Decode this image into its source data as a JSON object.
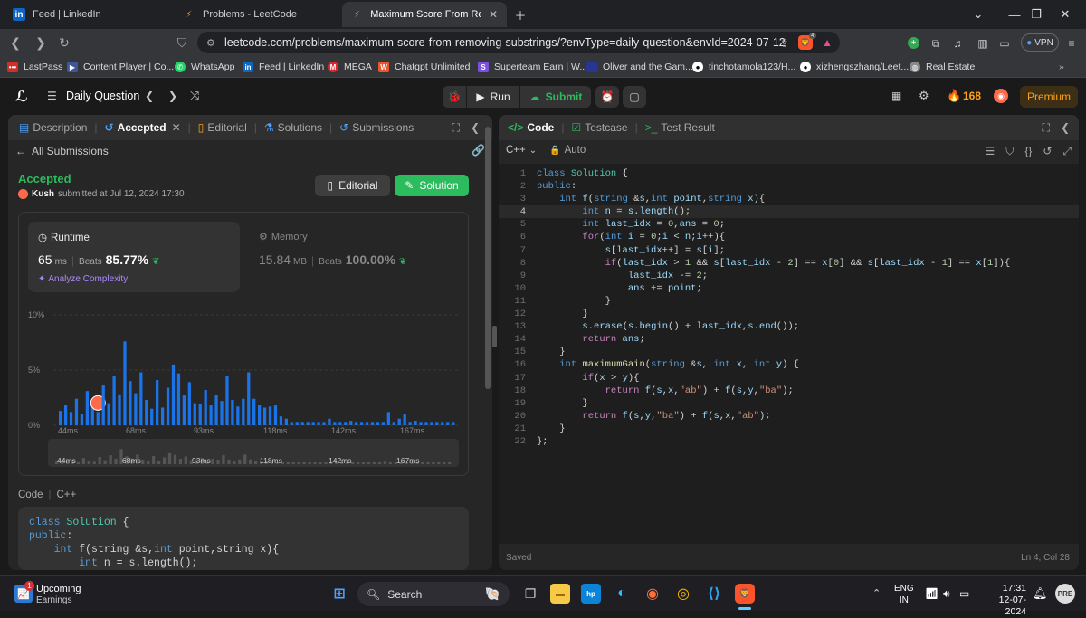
{
  "browser": {
    "tabs": [
      {
        "title": "Feed | LinkedIn",
        "favicon": "in"
      },
      {
        "title": "Problems - LeetCode",
        "favicon": "lc"
      },
      {
        "title": "Maximum Score From Removing",
        "favicon": "lc",
        "active": true
      }
    ],
    "url": "leetcode.com/problems/maximum-score-from-removing-substrings/?envType=daily-question&envId=2024-07-12",
    "vpn_label": "VPN",
    "brave_badge": "4",
    "bookmarks": [
      "LastPass",
      "Content Player | Co...",
      "WhatsApp",
      "Feed | LinkedIn",
      "MEGA",
      "Chatgpt Unlimited",
      "Superteam Earn | W...",
      "Oliver and the Gam...",
      "tinchotamola123/H...",
      "xizhengszhang/Leet...",
      "Real Estate"
    ]
  },
  "lc_header": {
    "problem_list": "Daily Question",
    "run": "Run",
    "submit": "Submit",
    "streak": "168",
    "premium": "Premium"
  },
  "left_panel": {
    "tabs": {
      "description": "Description",
      "accepted": "Accepted",
      "editorial": "Editorial",
      "solutions": "Solutions",
      "submissions": "Submissions"
    },
    "all_submissions": "All Submissions",
    "status": "Accepted",
    "user": "Kush",
    "submitted_text": "submitted at Jul 12, 2024 17:30",
    "editorial_btn": "Editorial",
    "solution_btn": "Solution",
    "runtime": {
      "label": "Runtime",
      "value": "65",
      "unit": "ms",
      "beats_label": "Beats",
      "beats": "85.77%"
    },
    "memory": {
      "label": "Memory",
      "value": "15.84",
      "unit": "MB",
      "beats_label": "Beats",
      "beats": "100.00%"
    },
    "analyze": "Analyze Complexity",
    "code_label": "Code",
    "lang_label": "C++",
    "code_preview": [
      "class Solution {",
      "public:",
      "    int f(string &s,int point,string x){",
      "        int n = s.length();"
    ]
  },
  "chart_data": {
    "type": "bar",
    "y_ticks": [
      "10%",
      "5%",
      "0%"
    ],
    "ylim": [
      0,
      10
    ],
    "x_ticks": [
      "44ms",
      "68ms",
      "93ms",
      "118ms",
      "142ms",
      "167ms"
    ],
    "values": [
      1.3,
      1.8,
      1.2,
      2.4,
      1.0,
      3.1,
      1.8,
      1.2,
      3.6,
      2.0,
      4.5,
      2.8,
      7.6,
      4.0,
      2.9,
      4.8,
      2.3,
      1.5,
      4.1,
      1.6,
      3.4,
      5.5,
      4.7,
      2.7,
      3.9,
      2.0,
      1.9,
      3.2,
      1.8,
      2.7,
      2.2,
      4.5,
      2.3,
      1.7,
      2.4,
      4.8,
      2.4,
      1.8,
      1.6,
      1.7,
      1.8,
      0.8,
      0.6,
      0.3,
      0.3,
      0.3,
      0.3,
      0.3,
      0.3,
      0.3,
      0.6,
      0.3,
      0.3,
      0.3,
      0.4,
      0.3,
      0.3,
      0.3,
      0.3,
      0.3,
      0.3,
      1.2,
      0.3,
      0.6,
      1.0,
      0.3,
      0.4,
      0.3,
      0.3,
      0.3,
      0.3,
      0.3,
      0.3,
      0.3
    ],
    "highlight_index": 7,
    "bar_color": "#1a73e8",
    "grid": true
  },
  "right_panel": {
    "tabs": {
      "code": "Code",
      "testcase": "Testcase",
      "result": "Test Result"
    },
    "language": "C++",
    "auto": "Auto",
    "saved": "Saved",
    "cursor": "Ln 4, Col 28",
    "code_lines": [
      "class Solution {",
      "public:",
      "    int f(string &s,int point,string x){",
      "        int n = s.length();",
      "        int last_idx = 0,ans = 0;",
      "        for(int i = 0;i < n;i++){",
      "            s[last_idx++] = s[i];",
      "            if(last_idx > 1 && s[last_idx - 2] == x[0] && s[last_idx - 1] == x[1]){",
      "                last_idx -= 2;",
      "                ans += point;",
      "            }",
      "        }",
      "        s.erase(s.begin() + last_idx,s.end());",
      "        return ans;",
      "    }",
      "    int maximumGain(string &s, int x, int y) {",
      "        if(x > y){",
      "            return f(s,x,\"ab\") + f(s,y,\"ba\");",
      "        }",
      "        return f(s,y,\"ba\") + f(s,x,\"ab\");",
      "    }",
      "};"
    ]
  },
  "taskbar": {
    "weather_badge": "1",
    "widget_title": "Upcoming",
    "widget_sub": "Earnings",
    "search": "Search",
    "lang1": "ENG",
    "lang2": "IN",
    "time": "17:31",
    "date": "12-07-2024"
  }
}
